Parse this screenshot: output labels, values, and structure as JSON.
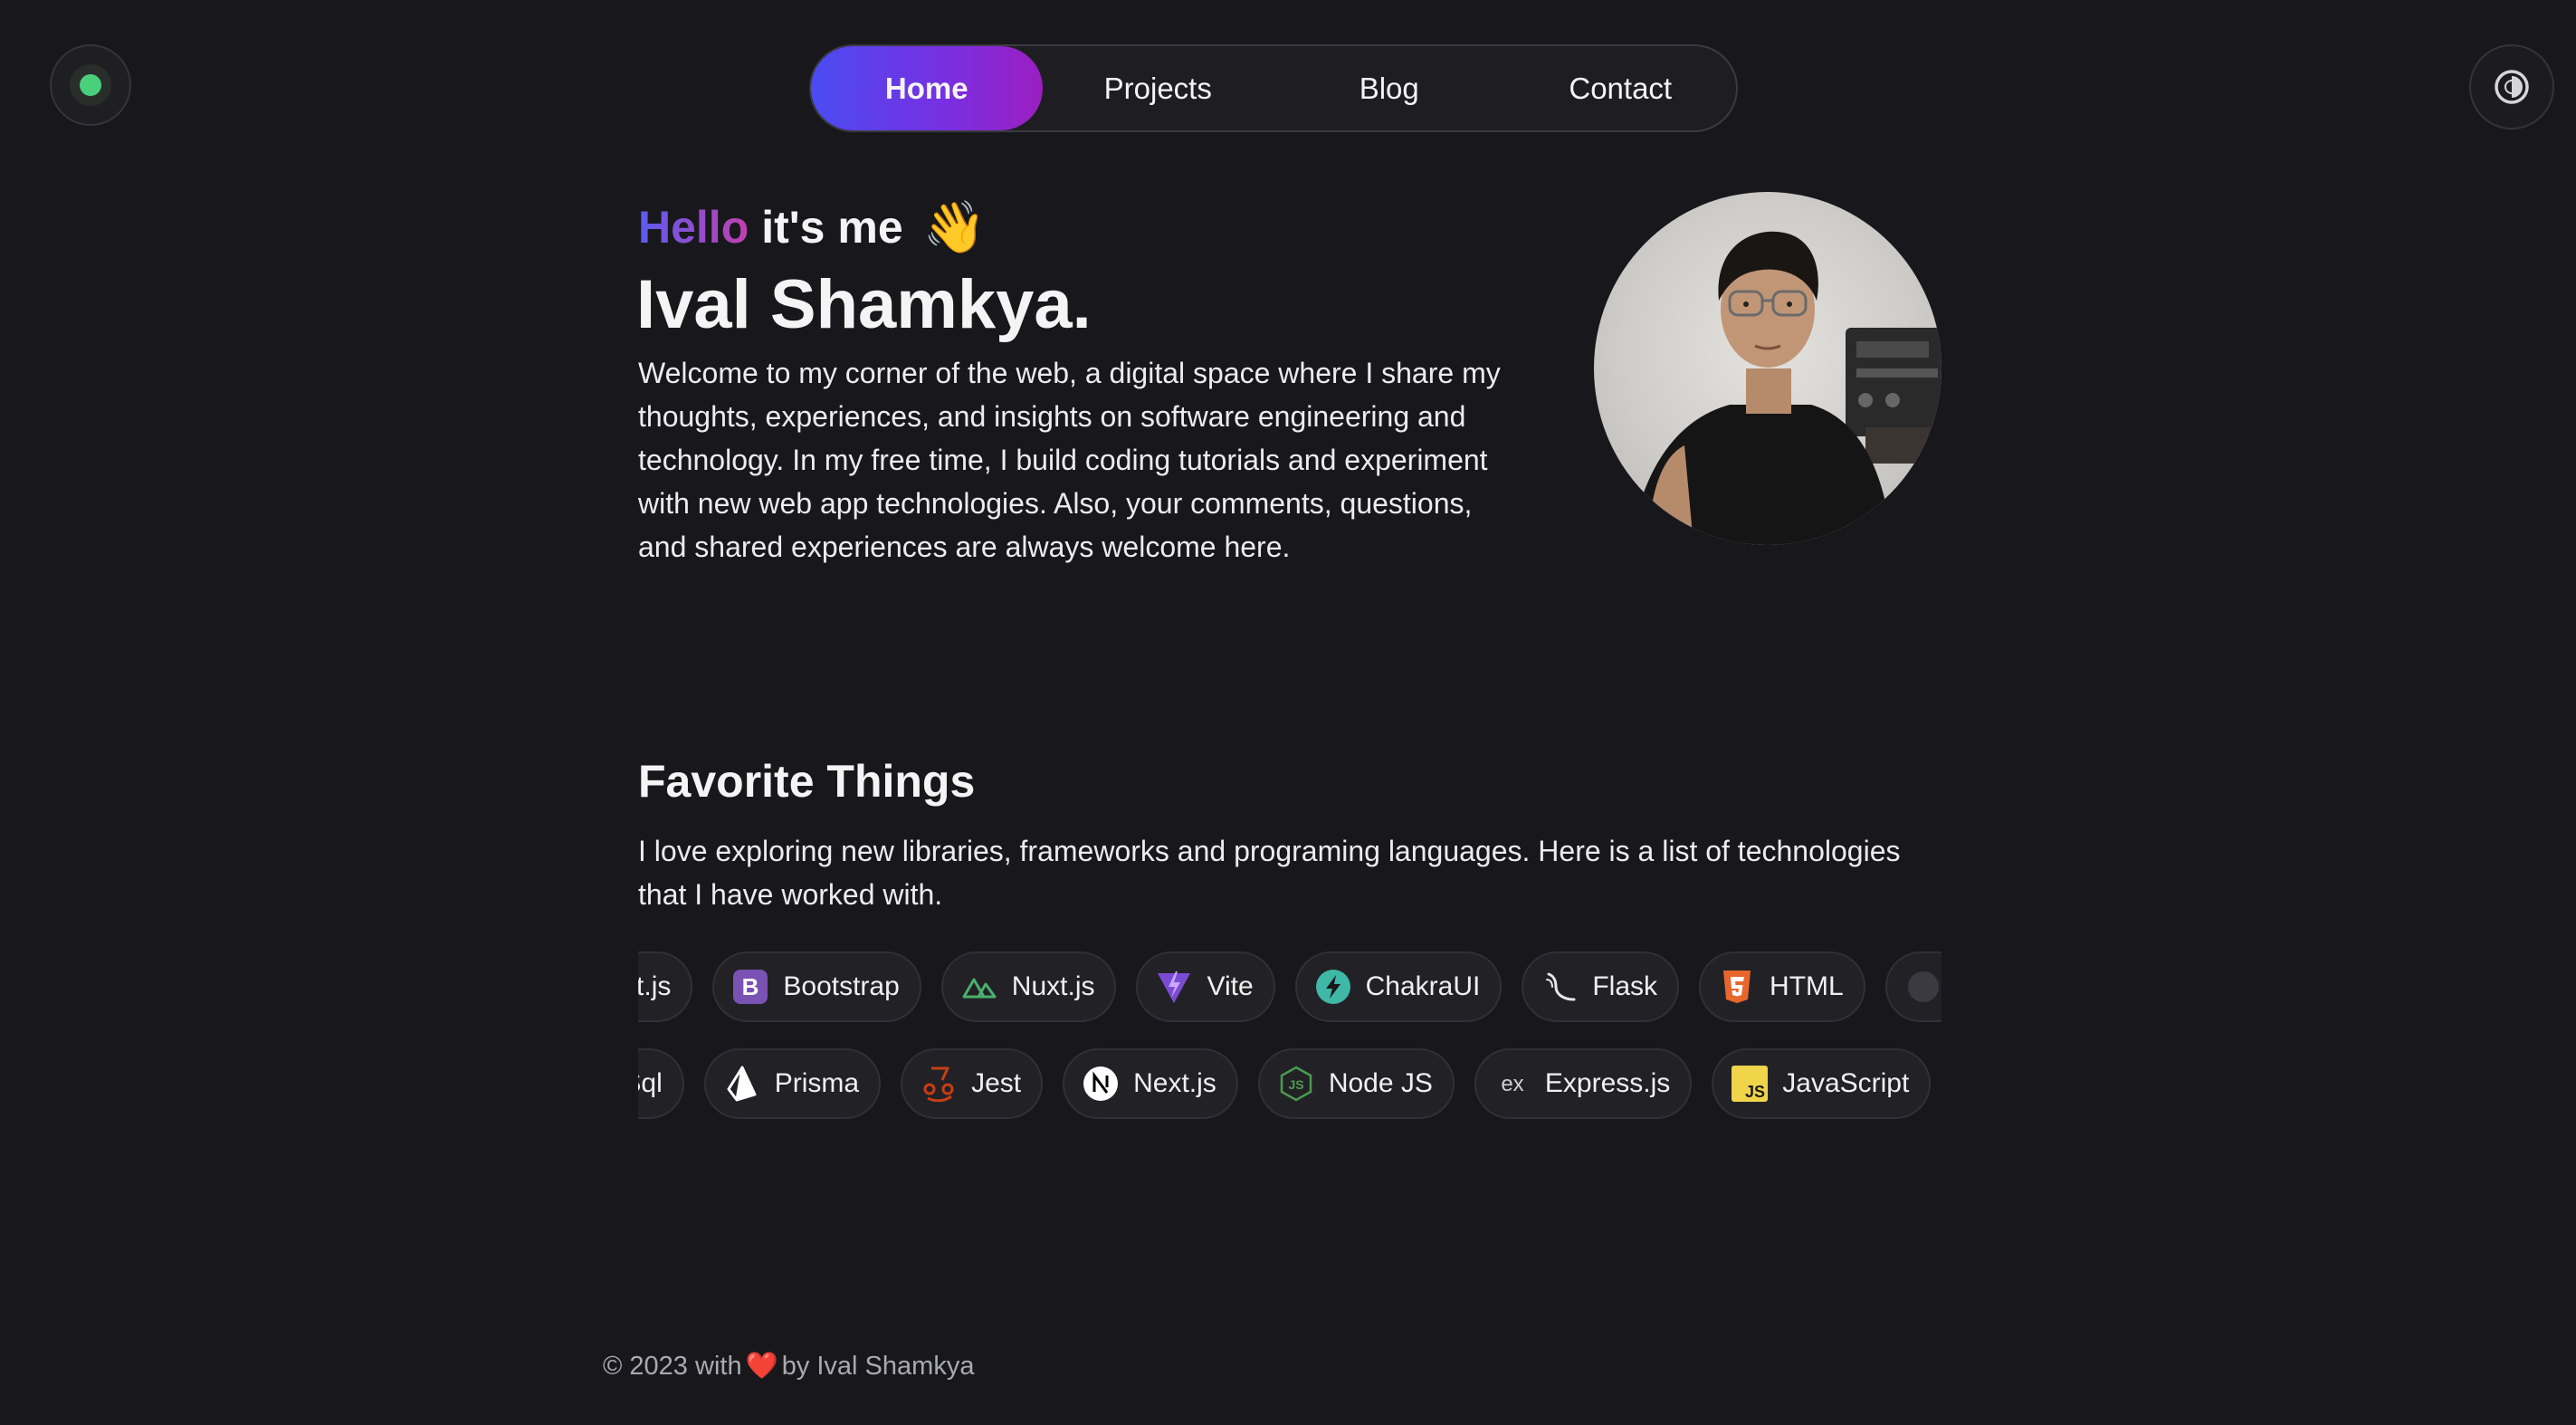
{
  "header": {
    "status_icon": "online-status-dot",
    "theme_icon": "theme-toggle-icon",
    "nav": {
      "items": [
        {
          "label": "Home",
          "active": true
        },
        {
          "label": "Projects",
          "active": false
        },
        {
          "label": "Blog",
          "active": false
        },
        {
          "label": "Contact",
          "active": false
        }
      ]
    }
  },
  "hero": {
    "greeting_highlight": "Hello",
    "greeting_rest": "it's me",
    "greeting_emoji": "👋",
    "name": "Ival Shamkya.",
    "intro": "Welcome to my corner of the web, a digital space where I share my thoughts, experiences, and insights on software engineering and technology. In my free time, I build coding tutorials and experiment with new web app technologies. Also, your comments, questions, and shared experiences are always welcome here.",
    "avatar_icon": "profile-photo"
  },
  "favorites": {
    "title": "Favorite Things",
    "description": "I love exploring new libraries, frameworks and programing languages. Here is a list of technologies that I have worked with.",
    "row1": [
      {
        "label": "React.js",
        "icon": "react-icon"
      },
      {
        "label": "Bootstrap",
        "icon": "bootstrap-icon"
      },
      {
        "label": "Nuxt.js",
        "icon": "nuxtjs-icon"
      },
      {
        "label": "Vite",
        "icon": "vite-icon"
      },
      {
        "label": "ChakraUI",
        "icon": "chakraui-icon"
      },
      {
        "label": "Flask",
        "icon": "flask-icon"
      },
      {
        "label": "HTML",
        "icon": "html5-icon"
      },
      {
        "label": "",
        "icon": "next-tech-icon"
      }
    ],
    "row2": [
      {
        "label": "PostgreSql",
        "icon": "postgresql-icon"
      },
      {
        "label": "Prisma",
        "icon": "prisma-icon"
      },
      {
        "label": "Jest",
        "icon": "jest-icon"
      },
      {
        "label": "Next.js",
        "icon": "nextjs-icon"
      },
      {
        "label": "Node JS",
        "icon": "nodejs-icon"
      },
      {
        "label": "Express.js",
        "icon": "expressjs-icon"
      },
      {
        "label": "JavaScript",
        "icon": "javascript-icon"
      }
    ]
  },
  "colors": {
    "background": "#18181c",
    "accent_start": "#4a4cf2",
    "accent_end": "#9b1fc0",
    "status_green": "#4ad07a"
  },
  "footer": {
    "prefix": "© 2023 with",
    "heart": "❤️",
    "suffix": "by Ival Shamkya"
  }
}
